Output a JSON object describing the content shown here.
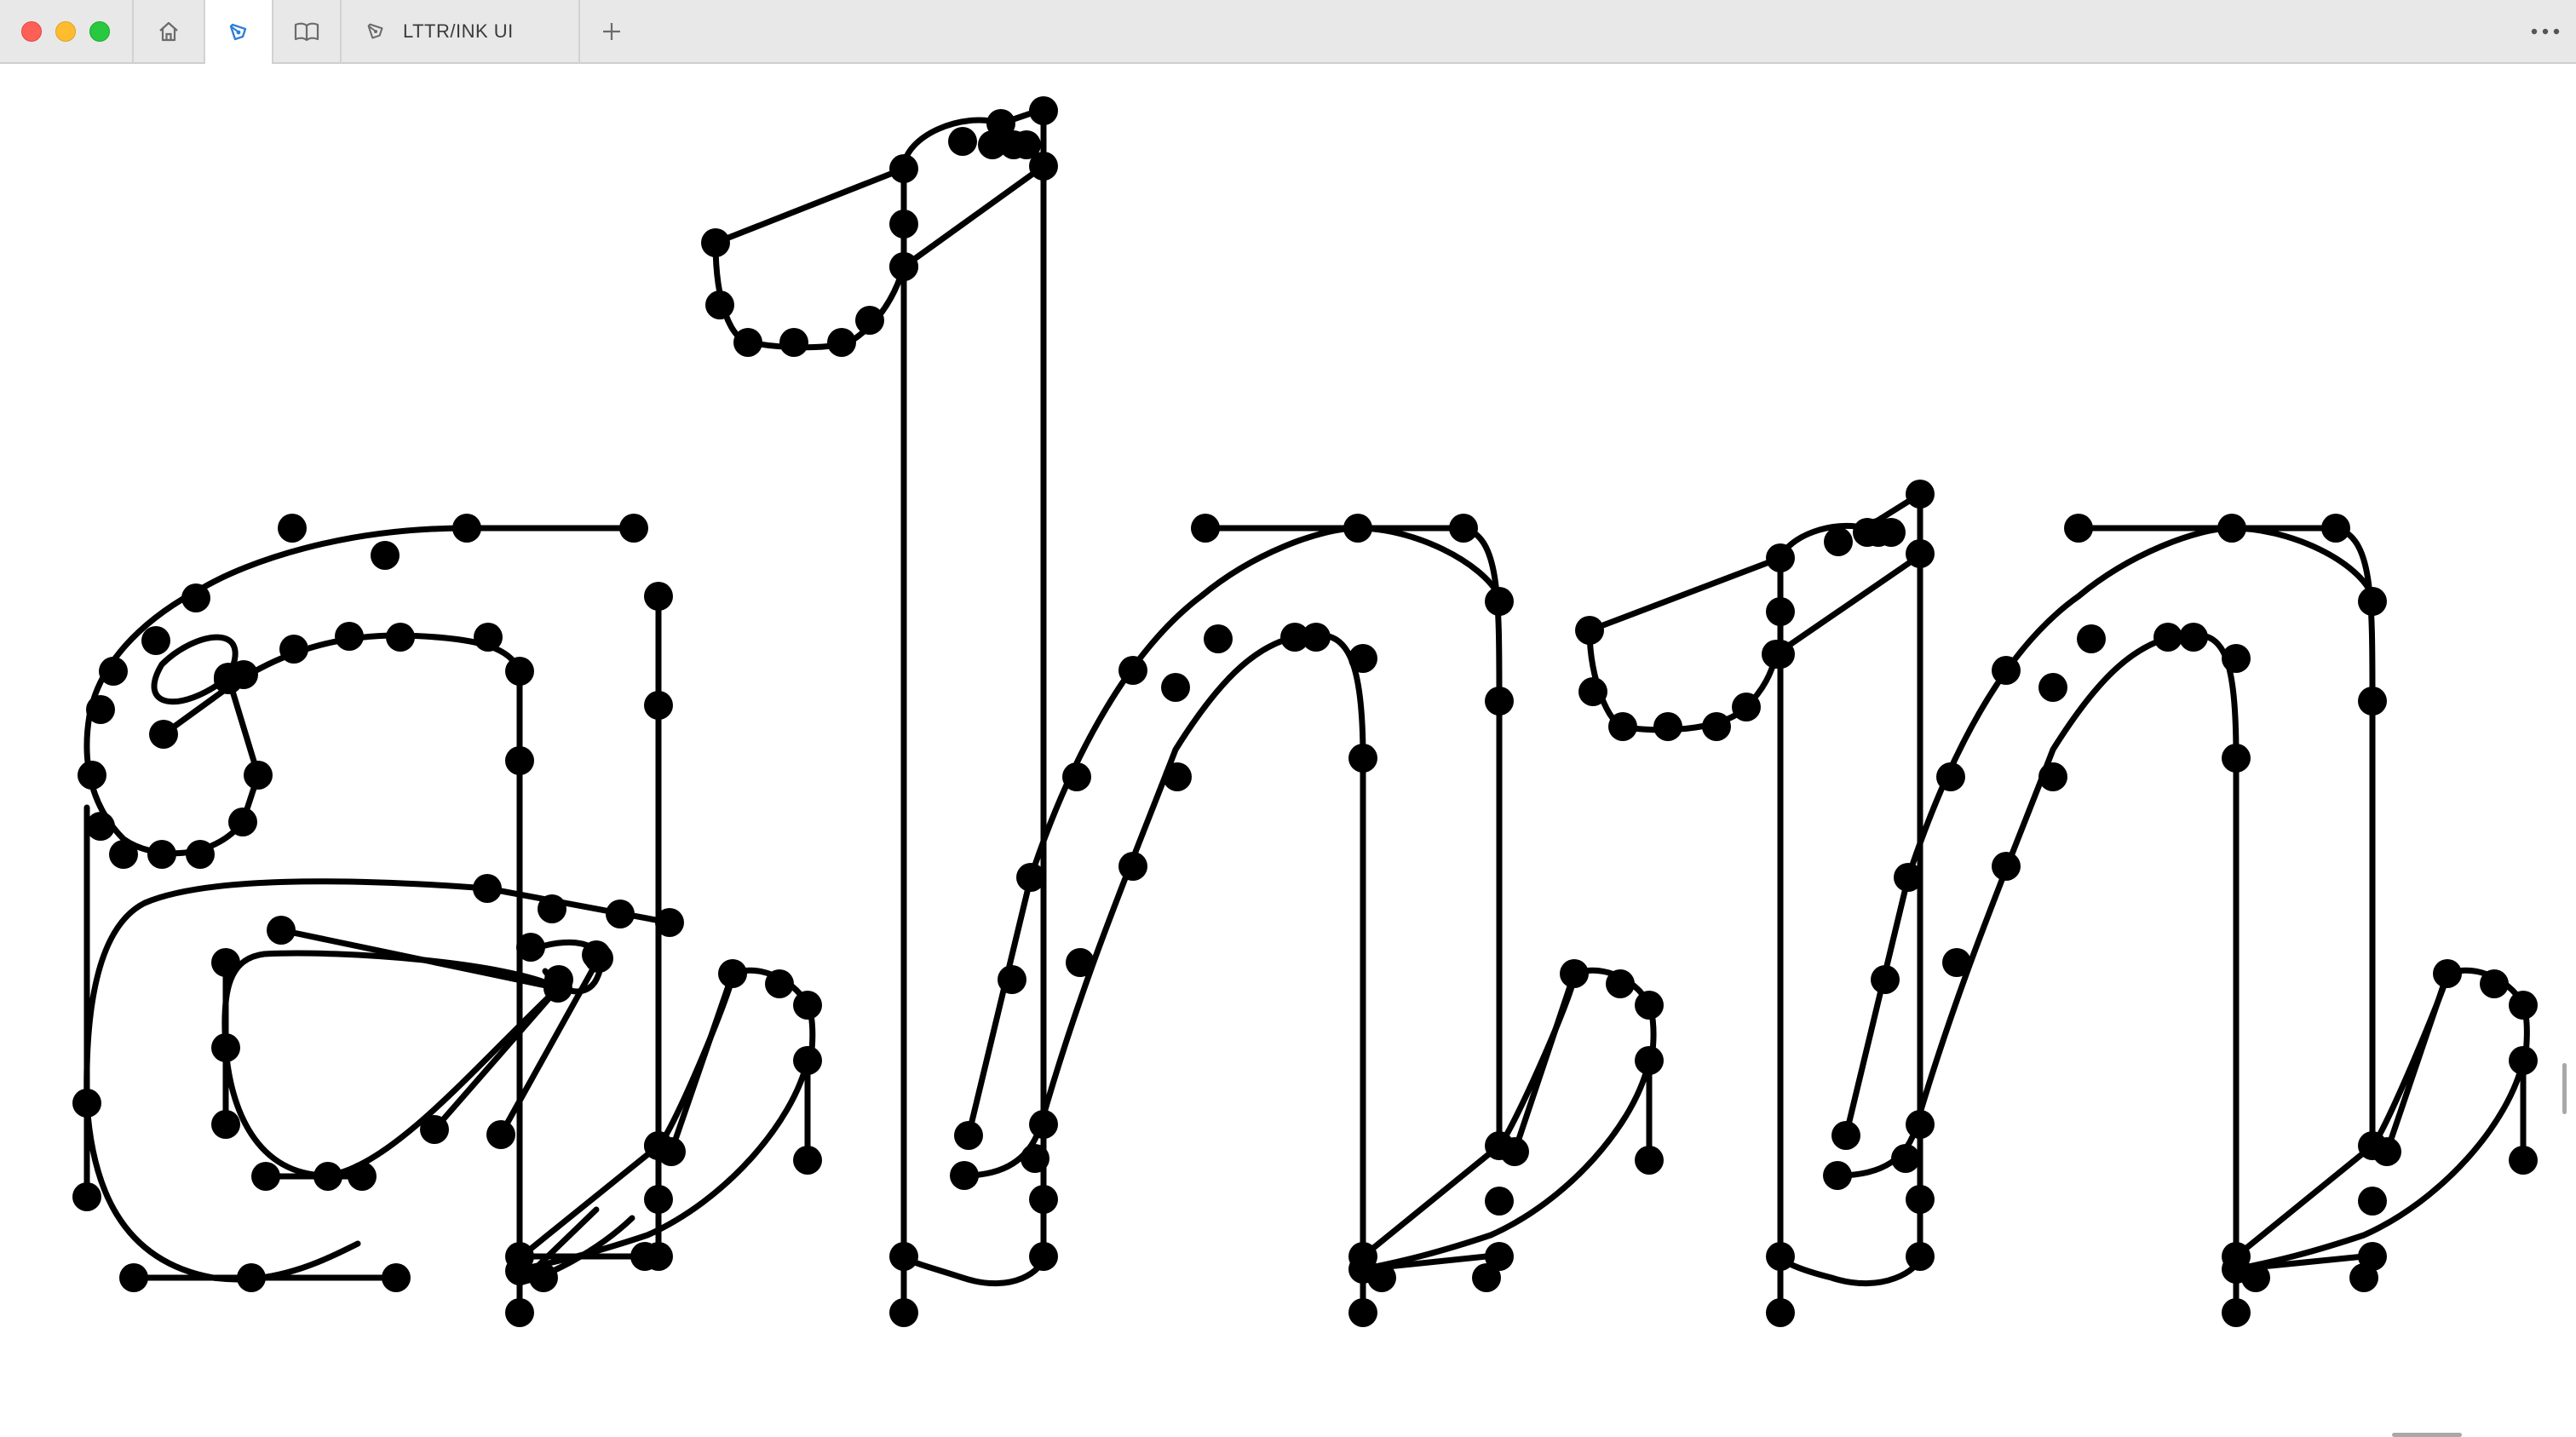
{
  "window": {
    "controls": [
      "close",
      "minimize",
      "maximize"
    ]
  },
  "tabs": {
    "home_icon": "home-icon",
    "pen_icon": "pen-nib-icon",
    "book_icon": "book-icon",
    "document": {
      "icon": "pen-nib-icon",
      "label": "LTTR/INK UI"
    },
    "new_tab_icon": "plus-icon",
    "more_icon": "more-horizontal-icon"
  },
  "canvas": {
    "glyphs": [
      "a",
      "l",
      "n",
      "ı",
      "n"
    ],
    "stroke_color": "#000000",
    "point_color": "#000000"
  },
  "colors": {
    "accent": "#2f7fd8",
    "tabbar": "#e8e8e8",
    "close": "#ff5f57",
    "minimize": "#febc2e",
    "maximize": "#28c840"
  }
}
